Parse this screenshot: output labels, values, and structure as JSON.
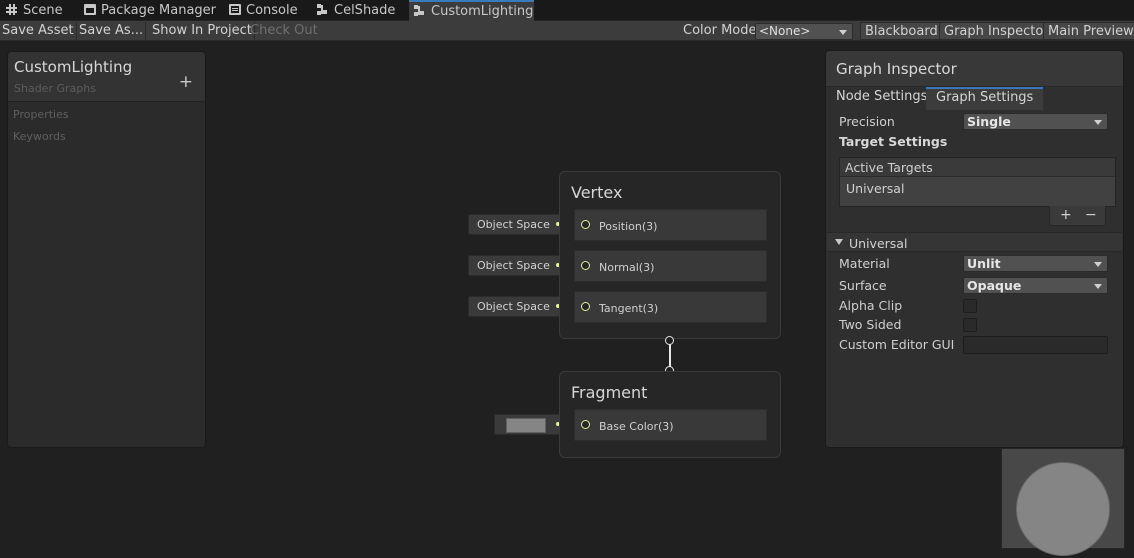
{
  "tabs": [
    {
      "label": "Scene",
      "icon": "scene-grid-icon"
    },
    {
      "label": "Package Manager",
      "icon": "package-icon"
    },
    {
      "label": "Console",
      "icon": "console-icon"
    },
    {
      "label": "CelShade",
      "icon": "shader-graph-icon"
    },
    {
      "label": "CustomLighting",
      "icon": "shader-graph-icon",
      "active": true
    }
  ],
  "toolbar": {
    "save_asset": "Save Asset",
    "save_as": "Save As...",
    "show_in_project": "Show In Project",
    "check_out": "Check Out",
    "color_mode_label": "Color Mode",
    "color_mode_value": "<None>",
    "blackboard": "Blackboard",
    "graph_inspector": "Graph Inspector",
    "main_preview": "Main Preview"
  },
  "blackboard": {
    "title": "CustomLighting",
    "subtitle": "Shader Graphs",
    "add_symbol": "+",
    "sections": [
      "Properties",
      "Keywords"
    ]
  },
  "vertex_node": {
    "title": "Vertex",
    "ports": [
      {
        "label": "Position(3)",
        "input": "Object Space"
      },
      {
        "label": "Normal(3)",
        "input": "Object Space"
      },
      {
        "label": "Tangent(3)",
        "input": "Object Space"
      }
    ]
  },
  "fragment_node": {
    "title": "Fragment",
    "ports": [
      {
        "label": "Base Color(3)",
        "input_color": "#858585"
      }
    ]
  },
  "inspector": {
    "title": "Graph Inspector",
    "tabs": [
      "Node Settings",
      "Graph Settings"
    ],
    "active_tab": "Graph Settings",
    "precision_label": "Precision",
    "precision_value": "Single",
    "target_settings": "Target Settings",
    "active_targets_header": "Active Targets",
    "active_targets": [
      "Universal"
    ],
    "add_symbol": "+",
    "remove_symbol": "−",
    "section_title": "Universal",
    "material_label": "Material",
    "material_value": "Unlit",
    "surface_label": "Surface",
    "surface_value": "Opaque",
    "alpha_clip_label": "Alpha Clip",
    "alpha_clip_checked": false,
    "two_sided_label": "Two Sided",
    "two_sided_checked": false,
    "custom_editor_label": "Custom Editor GUI",
    "custom_editor_value": ""
  },
  "colors": {
    "accent": "#3a79bb",
    "port_wire": "#e6f0a0",
    "background": "#202020"
  }
}
